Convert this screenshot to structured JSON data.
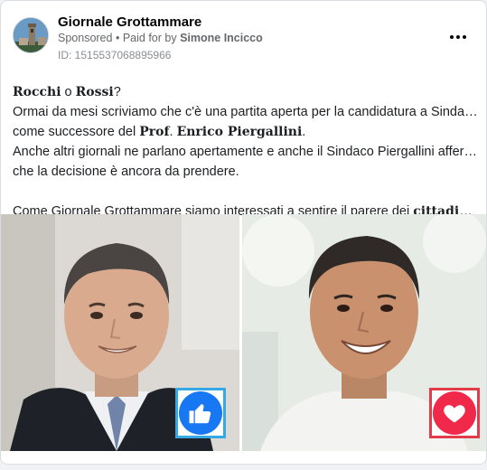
{
  "post": {
    "page_name": "Giornale Grottammare",
    "sponsored_label": "Sponsored",
    "separator": "•",
    "paid_for_prefix": "Paid for by",
    "paid_for_name": "Simone Incicco",
    "ad_id": "ID: 1515537068895966",
    "more_label": "..."
  },
  "body": {
    "line1_a": "Rocchi",
    "line1_b": " o ",
    "line1_c": "Rossi",
    "line1_d": "?",
    "line2": "Ormai da mesi scriviamo che c'è una partita aperta per la candidatura a Sindaco",
    "line3_a": "come successore del ",
    "line3_b": "Prof",
    "line3_c": ". ",
    "line3_d": "Enrico Piergallini",
    "line3_e": ".",
    "line4": "Anche altri giornali ne parlano apertamente e anche il Sindaco Piergallini afferma",
    "line5": "che la decisione è ancora da prendere.",
    "line7_a": "Come Giornale Grottammare siamo interessati a sentire il parere dei ",
    "line7_b": "cittadini di…"
  },
  "media": {
    "left_reaction": "like",
    "right_reaction": "love",
    "like_color": "#1877f2",
    "love_color": "#f02849"
  }
}
